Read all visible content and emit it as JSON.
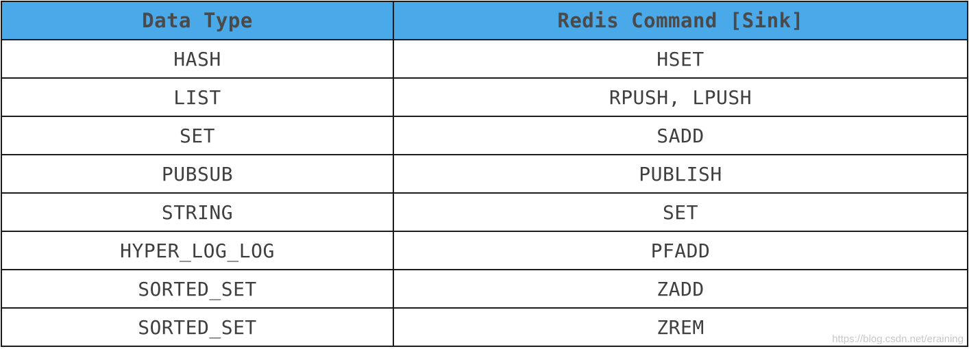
{
  "table": {
    "headers": [
      "Data Type",
      "Redis Command [Sink]"
    ],
    "rows": [
      [
        "HASH",
        "HSET"
      ],
      [
        "LIST",
        "RPUSH, LPUSH"
      ],
      [
        "SET",
        "SADD"
      ],
      [
        "PUBSUB",
        "PUBLISH"
      ],
      [
        "STRING",
        "SET"
      ],
      [
        "HYPER_LOG_LOG",
        "PFADD"
      ],
      [
        "SORTED_SET",
        "ZADD"
      ],
      [
        "SORTED_SET",
        "ZREM"
      ]
    ]
  },
  "watermark": "https://blog.csdn.net/eraining",
  "colors": {
    "header_background": "#4aa9e9",
    "header_text": "#4a4a4a",
    "cell_text": "#3f3f3f",
    "border": "#1a1a1a"
  }
}
